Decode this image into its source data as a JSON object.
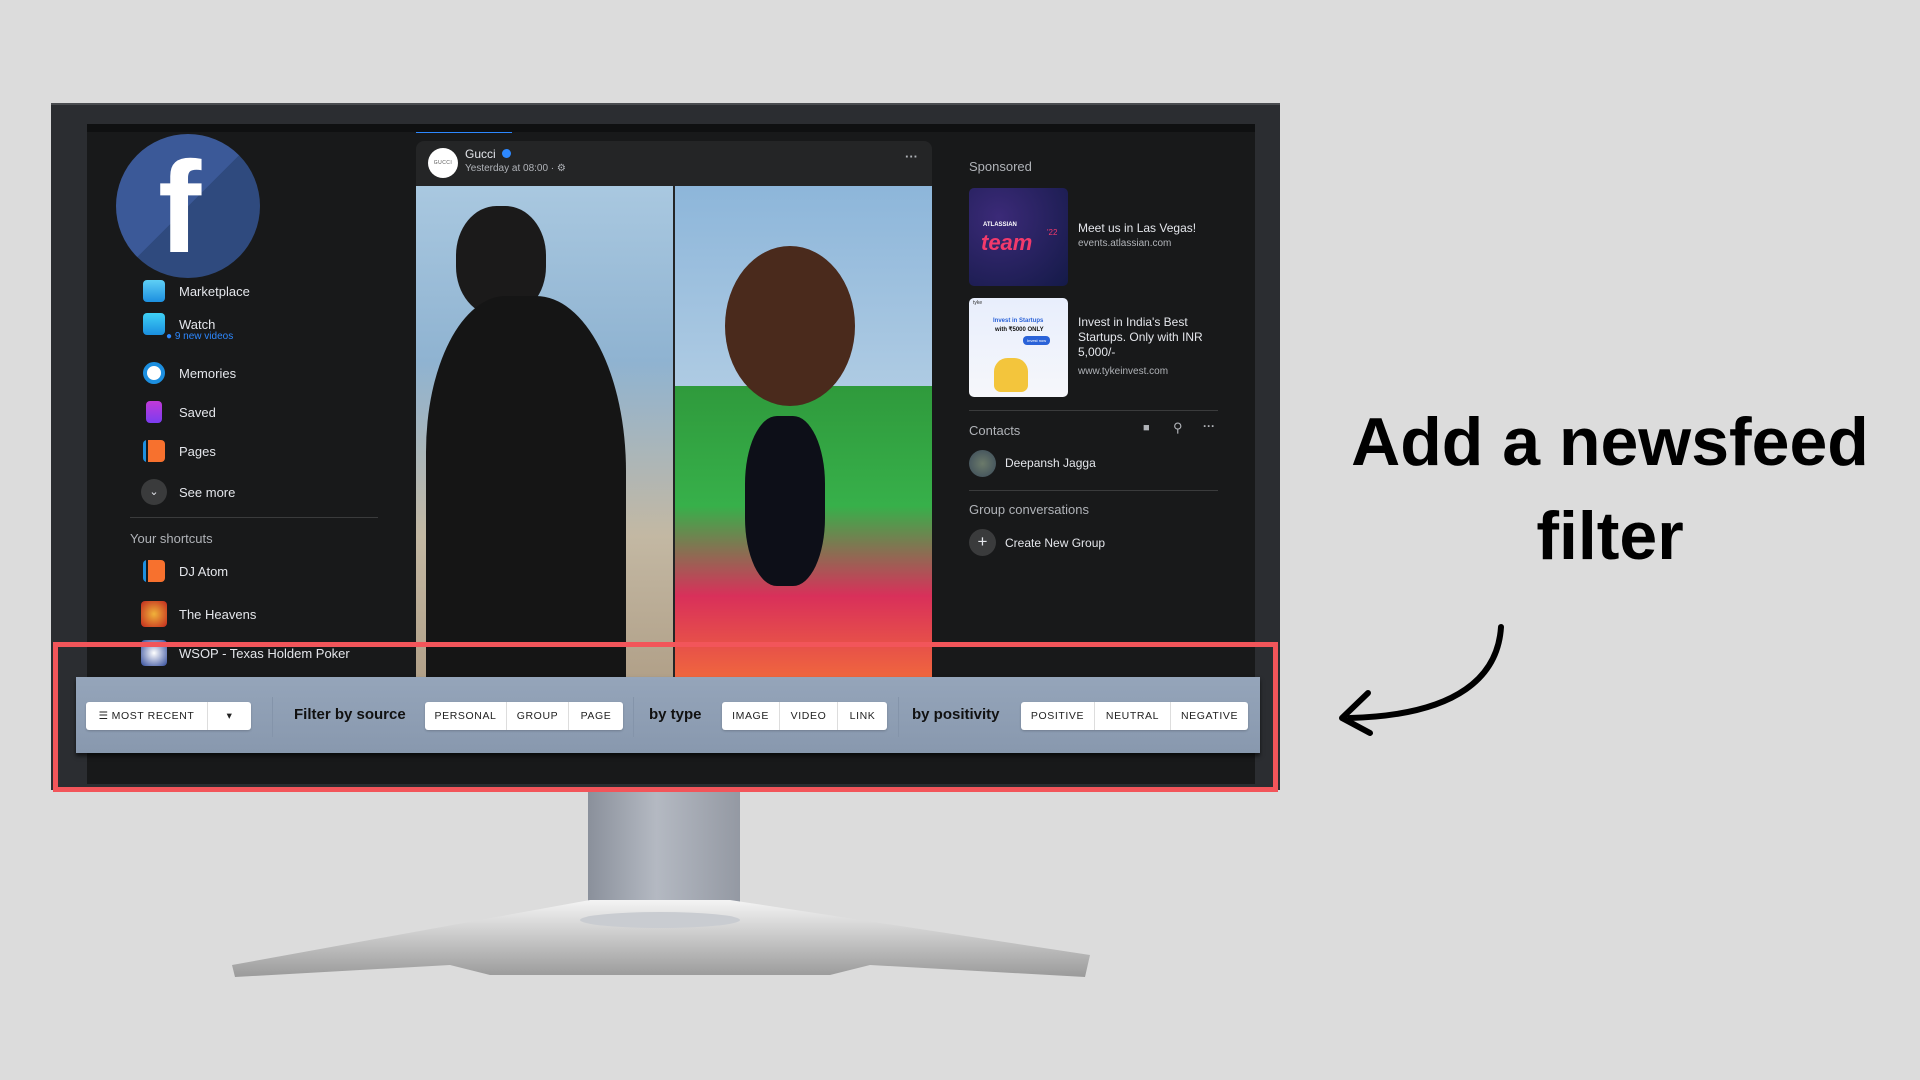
{
  "sidebar": {
    "items": [
      {
        "label": "Marketplace",
        "icon": "marketplace-icon"
      },
      {
        "label": "Watch",
        "sub": "9 new videos",
        "icon": "watch-icon"
      },
      {
        "label": "Memories",
        "icon": "memories-icon"
      },
      {
        "label": "Saved",
        "icon": "saved-icon"
      },
      {
        "label": "Pages",
        "icon": "pages-icon"
      },
      {
        "label": "See more",
        "icon": "chevron-down-icon"
      }
    ],
    "shortcuts_title": "Your shortcuts",
    "shortcuts": [
      {
        "label": "DJ Atom"
      },
      {
        "label": "The Heavens"
      },
      {
        "label": "WSOP - Texas Holdem Poker"
      }
    ]
  },
  "post": {
    "author": "Gucci",
    "avatar_text": "GUCCI",
    "time": "Yesterday at 08:00 ·",
    "more": "···"
  },
  "right": {
    "sponsored_title": "Sponsored",
    "ads": [
      {
        "title": "Meet us in Las Vegas!",
        "url": "events.atlassian.com",
        "img_brand": "ATLASSIAN",
        "img_text": "team",
        "img_year": "'22"
      },
      {
        "title": "Invest in India's Best Startups. Only with INR 5,000/-",
        "url": "www.tykeinvest.com",
        "img_brand": "tyke",
        "img_line1": "Invest in Startups",
        "img_line2": "with ₹5000 ONLY",
        "img_button": "Invest now"
      }
    ],
    "contacts_title": "Contacts",
    "contacts": [
      {
        "name": "Deepansh Jagga"
      }
    ],
    "groups_title": "Group conversations",
    "create_group": "Create New Group"
  },
  "filter": {
    "sort_label": "MOST RECENT",
    "source_label": "Filter by source",
    "source_options": [
      "PERSONAL",
      "GROUP",
      "PAGE"
    ],
    "type_label": "by type",
    "type_options": [
      "IMAGE",
      "VIDEO",
      "LINK"
    ],
    "positivity_label": "by positivity",
    "positivity_options": [
      "POSITIVE",
      "NEUTRAL",
      "NEGATIVE"
    ]
  },
  "annotation": {
    "line1": "Add a newsfeed",
    "line2": "filter",
    "highlight_color": "#f2555a"
  }
}
